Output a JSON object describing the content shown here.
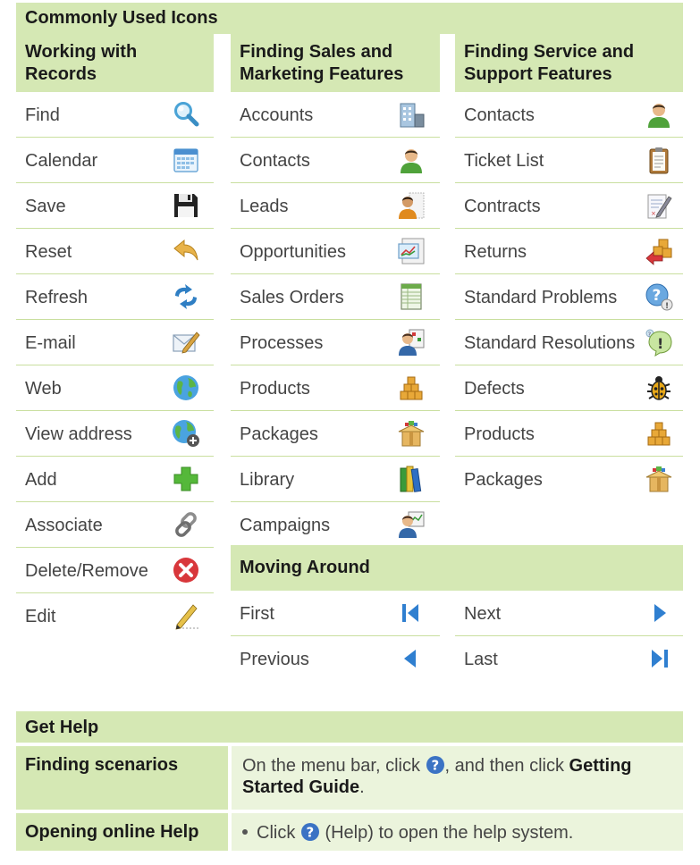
{
  "title": "Commonly Used Icons",
  "columns": [
    {
      "header": [
        "Working with",
        "Records"
      ],
      "items": [
        {
          "label": "Find",
          "icon": "magnifier-icon"
        },
        {
          "label": "Calendar",
          "icon": "calendar-icon"
        },
        {
          "label": "Save",
          "icon": "floppy-disk-icon"
        },
        {
          "label": "Reset",
          "icon": "undo-arrow-icon"
        },
        {
          "label": "Refresh",
          "icon": "refresh-arrows-icon"
        },
        {
          "label": "E-mail",
          "icon": "email-pencil-icon"
        },
        {
          "label": "Web",
          "icon": "globe-icon"
        },
        {
          "label": "View address",
          "icon": "globe-add-icon"
        },
        {
          "label": "Add",
          "icon": "plus-icon"
        },
        {
          "label": "Associate",
          "icon": "chain-link-icon"
        },
        {
          "label": "Delete/Remove",
          "icon": "delete-x-icon"
        },
        {
          "label": "Edit",
          "icon": "pencil-icon"
        }
      ]
    },
    {
      "header": [
        "Finding Sales and",
        "Marketing Features"
      ],
      "items": [
        {
          "label": "Accounts",
          "icon": "building-icon"
        },
        {
          "label": "Contacts",
          "icon": "person-icon"
        },
        {
          "label": "Leads",
          "icon": "lead-person-icon"
        },
        {
          "label": "Opportunities",
          "icon": "chart-document-icon"
        },
        {
          "label": "Sales Orders",
          "icon": "spreadsheet-icon"
        },
        {
          "label": "Processes",
          "icon": "process-person-icon"
        },
        {
          "label": "Products",
          "icon": "boxes-icon"
        },
        {
          "label": "Packages",
          "icon": "package-icon"
        },
        {
          "label": "Library",
          "icon": "books-icon"
        },
        {
          "label": "Campaigns",
          "icon": "campaign-person-icon"
        }
      ]
    },
    {
      "header": [
        "Finding Service and",
        "Support Features"
      ],
      "items": [
        {
          "label": "Contacts",
          "icon": "person-icon"
        },
        {
          "label": "Ticket List",
          "icon": "clipboard-icon"
        },
        {
          "label": "Contracts",
          "icon": "contract-pen-icon"
        },
        {
          "label": "Returns",
          "icon": "return-boxes-icon"
        },
        {
          "label": "Standard Problems",
          "icon": "question-bubble-icon"
        },
        {
          "label": "Standard Resolutions",
          "icon": "exclamation-bubble-icon"
        },
        {
          "label": "Defects",
          "icon": "bug-icon"
        },
        {
          "label": "Products",
          "icon": "boxes-icon"
        },
        {
          "label": "Packages",
          "icon": "package-icon"
        }
      ]
    }
  ],
  "moving_around": {
    "header": "Moving Around",
    "items": [
      {
        "label": "First",
        "icon": "first-icon"
      },
      {
        "label": "Next",
        "icon": "next-icon"
      },
      {
        "label": "Previous",
        "icon": "previous-icon"
      },
      {
        "label": "Last",
        "icon": "last-icon"
      }
    ]
  },
  "get_help": {
    "header": "Get Help",
    "rows": [
      {
        "label": "Finding scenarios",
        "text_before": "On the menu bar, click ",
        "text_middle": ", and then click ",
        "bold_text": "Getting Started Guide",
        "text_after": "."
      },
      {
        "label": "Opening online Help",
        "text_before": "Click ",
        "text_after": " (Help) to open the help system."
      }
    ]
  }
}
